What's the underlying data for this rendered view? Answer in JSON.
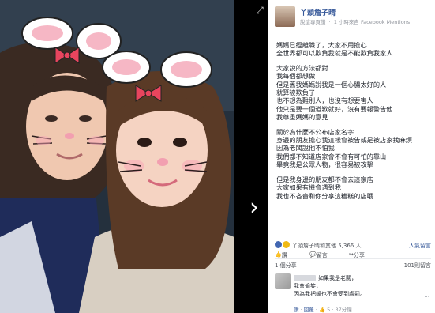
{
  "viewer": {
    "expand_icon": "expand-icon",
    "next_icon": "chevron-right-icon",
    "filter_overlay": {
      "left_ears": "bunny-ears-pink-bow",
      "right_ears": "bunny-ears-pink-bow"
    }
  },
  "post": {
    "page_name": "丫頭詹子晴",
    "author_role": "說這專頁讚",
    "time": "1 小時來自",
    "via": "Facebook Mentions",
    "globe_icon": "globe-icon",
    "lines": [
      [
        "媽媽已經離職了，大家不用擔心",
        "全世界都可以欺負我就是不能欺負我家人"
      ],
      [
        "大家說的方法都對",
        "我每個都想做",
        "但是舊我媽媽說我是一個心腸太好的人",
        "就算被欺負了",
        "也不想為難別人，也沒有想要害人",
        "他只是要一個道歉就好，沒有要報警告他",
        "我尊重媽媽的意見"
      ],
      [
        "關於為什麼不公布店家名字",
        "身邊的朋友擔心我這樣會被告或是被店家找麻煩",
        "因為老闆說他不怕我",
        "我們都不知道店家會不會有可怕的靠山",
        "畢竟我是公眾人物，很容易被攻擊"
      ],
      [
        "但是我身邊的朋友都不會去這家店",
        "大家如果有機會遇到我",
        "我也不吝嗇和你分享這糟糕的店哦"
      ]
    ]
  },
  "reactions": {
    "summary": "丫頭詹子晴和其他 5,366 人",
    "right_label": "人氣留言",
    "colors": [
      "#4267b2",
      "#f0ba15",
      "#f25268"
    ]
  },
  "actions": {
    "like": "讚",
    "comment": "留言",
    "share": "分享"
  },
  "counts": {
    "shares": "1 個分享",
    "comments": "101則留言"
  },
  "comment": {
    "line1": "如果我是老闆，",
    "line2": "我會偷笑，",
    "line3": "因為我把鍋也不會受到處罰。",
    "more": "...",
    "like": "讚",
    "reply": "回覆",
    "reaction_count": "5",
    "time": "37分鐘"
  },
  "accent": "#365899"
}
